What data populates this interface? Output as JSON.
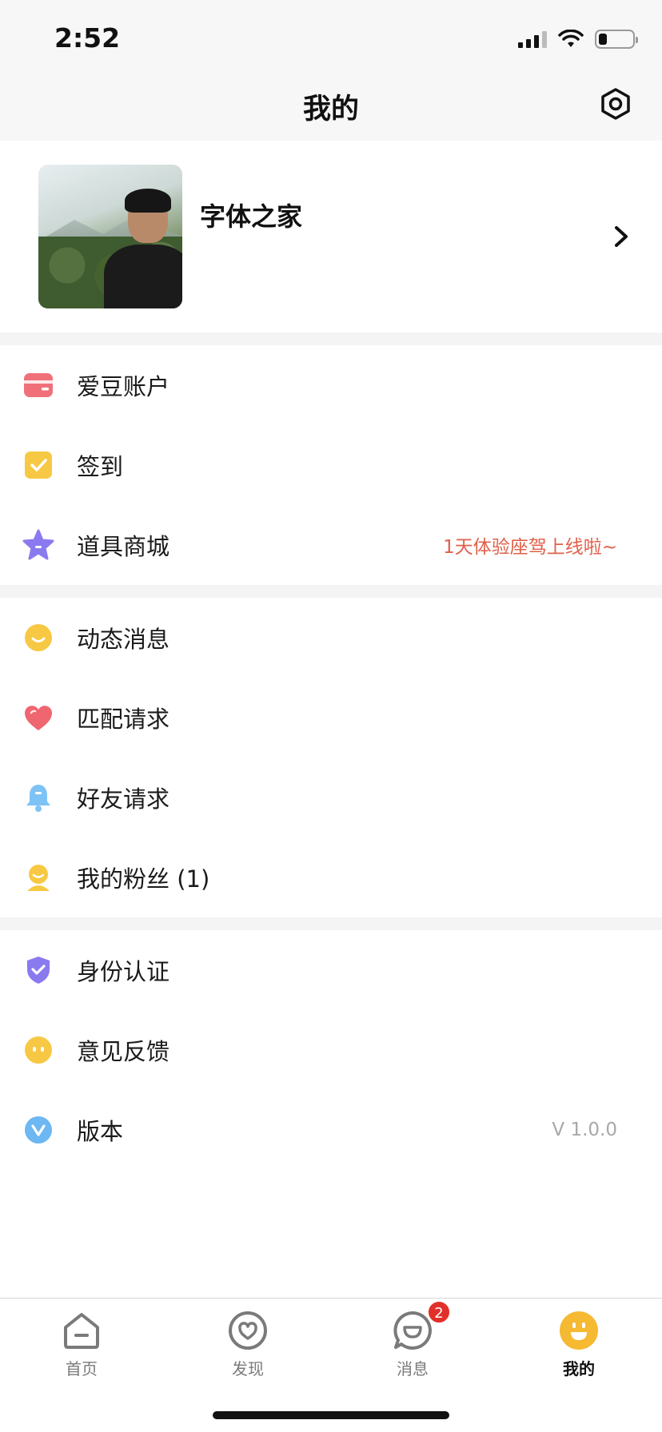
{
  "status_bar": {
    "time": "2:52",
    "battery_level": 0.25
  },
  "nav": {
    "title": "我的"
  },
  "profile": {
    "name": "字体之家"
  },
  "groups": [
    {
      "items": [
        {
          "label": "爱豆账户",
          "icon": "wallet-icon",
          "color": "#f0707a"
        },
        {
          "label": "签到",
          "icon": "checkin-icon",
          "color": "#f7c843"
        },
        {
          "label": "道具商城",
          "icon": "star-icon",
          "color": "#8a7af0",
          "aside": "1天体验座驾上线啦~"
        }
      ]
    },
    {
      "items": [
        {
          "label": "动态消息",
          "icon": "smile-icon",
          "color": "#f7c843"
        },
        {
          "label": "匹配请求",
          "icon": "heart-icon",
          "color": "#ef6670"
        },
        {
          "label": "好友请求",
          "icon": "bell-icon",
          "color": "#7ec3f5"
        },
        {
          "label": "我的粉丝 (1)",
          "icon": "fan-icon",
          "color": "#f7c843"
        }
      ]
    },
    {
      "items": [
        {
          "label": "身份认证",
          "icon": "shield-check-icon",
          "color": "#8a7af0"
        },
        {
          "label": "意见反馈",
          "icon": "feedback-icon",
          "color": "#f7c843"
        },
        {
          "label": "版本",
          "icon": "version-icon",
          "color": "#6db7f2",
          "aside": "V 1.0.0"
        }
      ]
    }
  ],
  "tabs": [
    {
      "label": "首页",
      "icon": "home-icon"
    },
    {
      "label": "发现",
      "icon": "discover-icon"
    },
    {
      "label": "消息",
      "icon": "message-icon",
      "badge": "2"
    },
    {
      "label": "我的",
      "icon": "me-icon",
      "active": true
    }
  ],
  "colors": {
    "accent": "#f5b932",
    "promo": "#e0604a",
    "badge": "#e1302a"
  }
}
